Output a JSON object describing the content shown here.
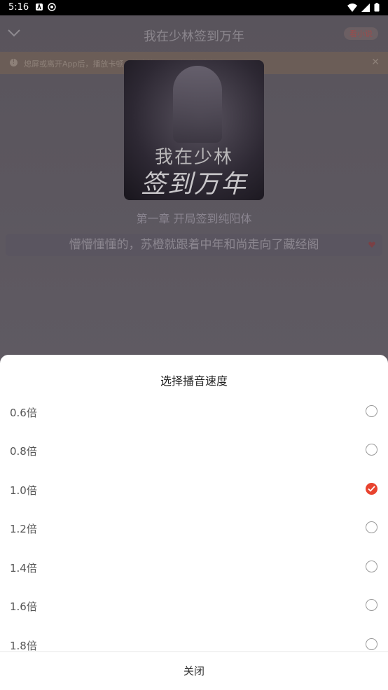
{
  "status_bar": {
    "time": "5:16"
  },
  "header": {
    "title": "我在少林签到万年",
    "badge": "看小说"
  },
  "notice": {
    "text": "熄屏或离开App后，播放卡顿、停止的问题【查看解决办法】",
    "icon": "info-icon"
  },
  "cover": {
    "title_line1": "我在少林",
    "title_line2": "签到万年"
  },
  "chapter": {
    "title": "第一章 开局签到纯阳体"
  },
  "reading": {
    "current_line": "懵懵懂懂的，苏橙就跟着中年和尚走向了藏经阁"
  },
  "speed_sheet": {
    "title": "选择播音速度",
    "options": [
      {
        "label": "0.6倍",
        "selected": false
      },
      {
        "label": "0.8倍",
        "selected": false
      },
      {
        "label": "1.0倍",
        "selected": true
      },
      {
        "label": "1.2倍",
        "selected": false
      },
      {
        "label": "1.4倍",
        "selected": false
      },
      {
        "label": "1.6倍",
        "selected": false
      },
      {
        "label": "1.8倍",
        "selected": false
      }
    ],
    "close_label": "关闭"
  },
  "colors": {
    "accent": "#e8432f",
    "sheet_bg": "#ffffff",
    "overlay": "#5f5a62"
  }
}
